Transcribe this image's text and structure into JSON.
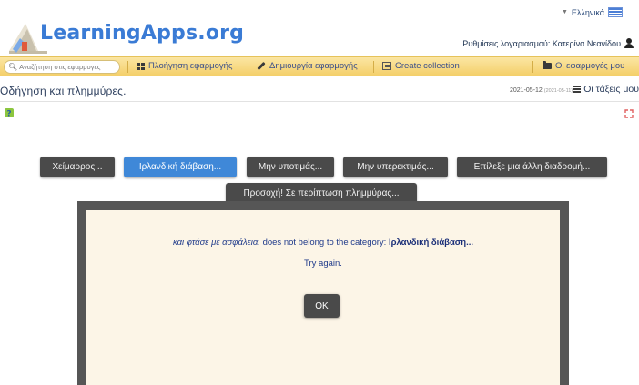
{
  "header": {
    "logo_text": "LearningApps.org",
    "language": "Ελληνικά",
    "account_settings": "Ρυθμίσεις λογαριασμού: Κατερίνα Νεανίδου"
  },
  "navbar": {
    "search_placeholder": "Αναζήτηση στις εφαρμογές",
    "items": [
      {
        "label": "Πλοήγηση εφαρμογής",
        "icon": "grid-icon"
      },
      {
        "label": "Δημιουργία εφαρμογής",
        "icon": "pencil-icon"
      },
      {
        "label": "Create collection",
        "icon": "collection-icon"
      },
      {
        "label": "Οι εφαρμογές μου",
        "icon": "folder-icon"
      }
    ]
  },
  "title_row": {
    "title": "Οδήγηση και πλημμύρες.",
    "date": "2021-05-12",
    "date_small": "(2021-05-11)",
    "tasks_label": "Οι τάξεις μου"
  },
  "app": {
    "categories": [
      "Χείμαρρος...",
      "Ιρλανδική διάβαση...",
      "Μην υποτιμάς...",
      "Μην υπερεκτιμάς...",
      "Επίλεξε μια άλλη διαδρομή...",
      "Προσοχή! Σε περίπτωση πλημμύρας..."
    ],
    "active_category_index": 1
  },
  "dialog": {
    "item_text": "και φτάσε με ασφάλεια.",
    "middle_text": "does not belong to the category:",
    "category_text": "Ιρλανδική διάβαση...",
    "retry_text": "Try again.",
    "ok_label": "OK"
  },
  "colors": {
    "accent_blue": "#3f88d8",
    "navbar_yellow": "#f4cf6a",
    "tile_dark": "#4a4a4a",
    "dialog_bg": "#fcf5e7",
    "dialog_text": "#1f3a8a"
  }
}
